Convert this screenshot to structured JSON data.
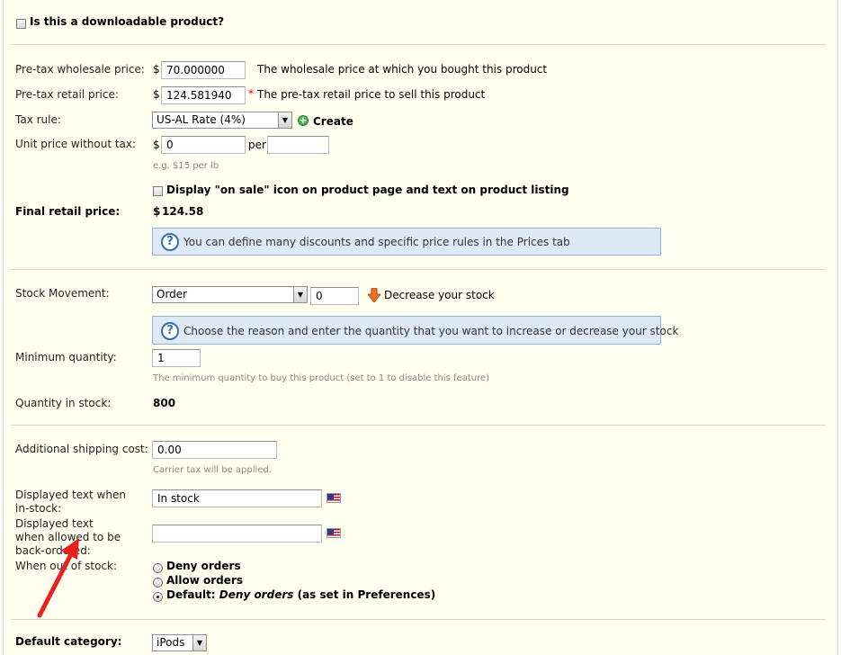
{
  "downloadable": {
    "label": "Is this a downloadable product?"
  },
  "prices": {
    "wholesale": {
      "label": "Pre-tax wholesale price:",
      "currency": "$",
      "value": "70.000000",
      "help": "The wholesale price at which you bought this product"
    },
    "retail": {
      "label": "Pre-tax retail price:",
      "currency": "$",
      "value": "124.581940",
      "required_mark": "*",
      "help": "The pre-tax retail price to sell this product"
    },
    "tax_rule": {
      "label": "Tax rule:",
      "value": "US-AL Rate (4%)",
      "create_label": "Create"
    },
    "unit_price": {
      "label": "Unit price without tax:",
      "currency": "$",
      "value": "0",
      "per_label": "per",
      "per_value": "",
      "hint": "e.g. $15 per lb"
    },
    "on_sale": {
      "label": "Display \"on sale\" icon on product page and text on product listing"
    },
    "final": {
      "label": "Final retail price:",
      "currency": "$",
      "value": "124.58"
    },
    "info": "You can define many discounts and specific price rules in the Prices tab"
  },
  "stock": {
    "movement": {
      "label": "Stock Movement:",
      "value": "Order",
      "quantity": "0",
      "direction_label": "Decrease your stock"
    },
    "info": "Choose the reason and enter the quantity that you want to increase or decrease your stock",
    "minimum": {
      "label": "Minimum quantity:",
      "value": "1",
      "hint": "The minimum quantity to buy this product (set to 1 to disable this feature)"
    },
    "in_stock": {
      "label": "Quantity in stock:",
      "value": "800"
    }
  },
  "shipping": {
    "additional": {
      "label": "Additional shipping cost:",
      "value": "0.00",
      "hint": "Carrier tax will be applied."
    },
    "text_in_stock": {
      "label": "Displayed text when in-stock:",
      "value": "In stock"
    },
    "text_backorder": {
      "label": "Displayed text when allowed to be back-ordered:",
      "value": ""
    },
    "out_of_stock": {
      "label": "When out of stock:",
      "options": [
        "Deny orders",
        "Allow orders"
      ],
      "default_prefix": "Default:",
      "default_value": "Deny orders",
      "default_suffix": "(as set in Preferences)"
    }
  },
  "category": {
    "label": "Default category:",
    "value": "iPods"
  },
  "colors": {
    "panel_bg": "#FFFFF0",
    "separator": "#DFD5C3",
    "info_bg": "#DDE9F7",
    "info_border": "#93B4D6",
    "arrow_red": "#E8201E"
  }
}
